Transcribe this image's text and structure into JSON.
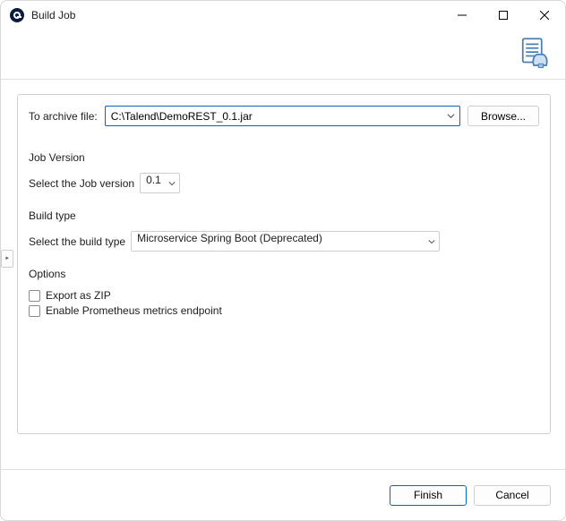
{
  "window": {
    "title": "Build Job"
  },
  "archive": {
    "label": "To archive file:",
    "value": "C:\\Talend\\DemoREST_0.1.jar",
    "browse": "Browse..."
  },
  "jobVersion": {
    "title": "Job Version",
    "label": "Select the Job version",
    "value": "0.1"
  },
  "buildType": {
    "title": "Build type",
    "label": "Select the build type",
    "value": "Microservice Spring Boot (Deprecated)"
  },
  "options": {
    "title": "Options",
    "exportZip": "Export as ZIP",
    "prometheus": "Enable Prometheus metrics endpoint"
  },
  "footer": {
    "finish": "Finish",
    "cancel": "Cancel"
  },
  "expandHandle": "‣"
}
